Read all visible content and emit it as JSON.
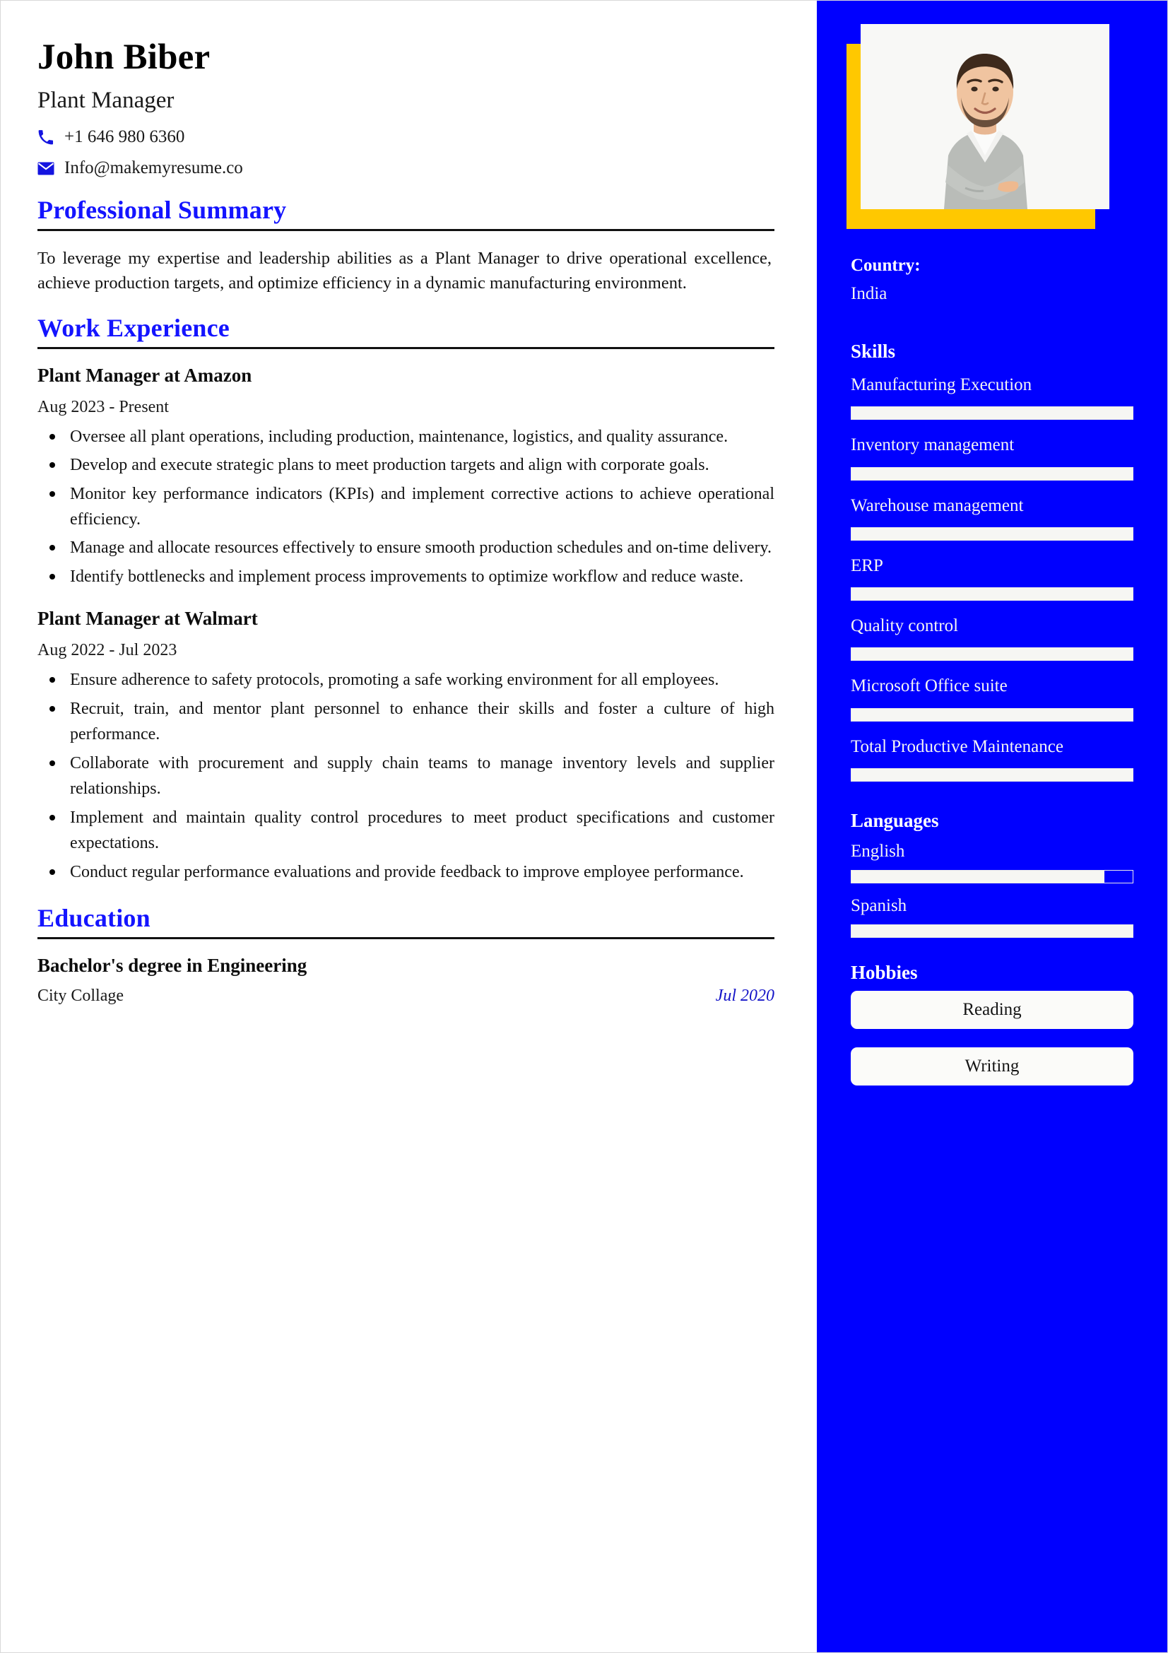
{
  "header": {
    "name": "John Biber",
    "job_title": "Plant Manager",
    "phone": "+1 646 980 6360",
    "email": "Info@makemyresume.co",
    "phone_icon": "phone-icon",
    "email_icon": "envelope-icon"
  },
  "sections": {
    "summary_heading": "Professional Summary",
    "summary_text": "To leverage my expertise and leadership abilities as a Plant Manager to drive operational excellence, achieve production targets, and optimize efficiency in a dynamic manufacturing environment.",
    "experience_heading": "Work Experience",
    "education_heading": "Education"
  },
  "experience": [
    {
      "title": "Plant Manager at Amazon",
      "dates": "Aug 2023 - Present",
      "bullets": [
        "Oversee all plant operations, including production, maintenance, logistics, and quality assurance.",
        "Develop and execute strategic plans to meet production targets and align with corporate goals.",
        "Monitor key performance indicators (KPIs) and implement corrective actions to achieve operational efficiency.",
        "Manage and allocate resources effectively to ensure smooth production schedules and on-time delivery.",
        "Identify bottlenecks and implement process improvements to optimize workflow and reduce waste."
      ]
    },
    {
      "title": "Plant Manager at Walmart",
      "dates": "Aug 2022 - Jul 2023",
      "bullets": [
        "Ensure adherence to safety protocols, promoting a safe working environment for all employees.",
        "Recruit, train, and mentor plant personnel to enhance their skills and foster a culture of high performance.",
        "Collaborate with procurement and supply chain teams to manage inventory levels and supplier relationships.",
        "Implement and maintain quality control procedures to meet product specifications and customer expectations.",
        "Conduct regular performance evaluations and provide feedback to improve employee performance."
      ]
    }
  ],
  "education": [
    {
      "degree": "Bachelor's degree in Engineering",
      "school": "City Collage",
      "date": "Jul 2020"
    }
  ],
  "sidebar": {
    "country_label": "Country:",
    "country_value": "India",
    "skills_heading": "Skills",
    "skills": [
      {
        "name": "Manufacturing Execution",
        "level": 100
      },
      {
        "name": "Inventory management",
        "level": 100
      },
      {
        "name": "Warehouse management",
        "level": 100
      },
      {
        "name": "ERP",
        "level": 100
      },
      {
        "name": "Quality control",
        "level": 100
      },
      {
        "name": "Microsoft Office suite",
        "level": 100
      },
      {
        "name": "Total Productive Maintenance",
        "level": 100
      }
    ],
    "languages_heading": "Languages",
    "languages": [
      {
        "name": "English",
        "level": 90
      },
      {
        "name": "Spanish",
        "level": 100
      }
    ],
    "hobbies_heading": "Hobbies",
    "hobbies": [
      "Reading",
      "Writing"
    ]
  },
  "colors": {
    "sidebar_bg": "#0000FF",
    "accent_yellow": "#FFC800",
    "heading_blue": "#1414FF",
    "date_blue": "#1414C8",
    "text_dark": "#141414"
  }
}
